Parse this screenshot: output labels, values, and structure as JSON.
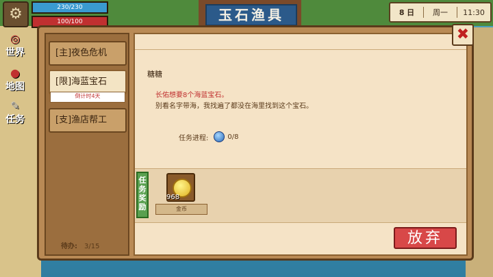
{
  "hud": {
    "hp_text": "230/230",
    "hp_fraction": 1.0,
    "mp_text": "100/100",
    "mp_fraction": 1.0,
    "day": "8",
    "day_unit": "日",
    "weekday": "周一",
    "time": "11:30"
  },
  "background": {
    "shop_sign": "玉石渔具"
  },
  "sidebar": {
    "world_label": "世界",
    "map_label": "地图",
    "tasks_label": "任务"
  },
  "quests": {
    "tabs": [
      {
        "label": "[主]夜色危机"
      },
      {
        "label": "[限]海蓝宝石",
        "countdown": "倒计时4天"
      },
      {
        "label": "[支]渔店帮工"
      }
    ],
    "todo_label": "待办:",
    "todo_value": "3/15"
  },
  "detail": {
    "npc": "糖糖",
    "line1": "长佑想要8个海蓝宝石。",
    "line2": "别看名字带海，我找遍了都没在海里找到这个宝石。",
    "progress_label": "任务进程:",
    "progress_value": "0/8",
    "reward_label": "任务奖励",
    "reward_count": "968",
    "reward_name": "金币",
    "abandon_label": "放弃"
  },
  "colors": {
    "accent": "#c03030",
    "reward_green": "#5aa050"
  }
}
